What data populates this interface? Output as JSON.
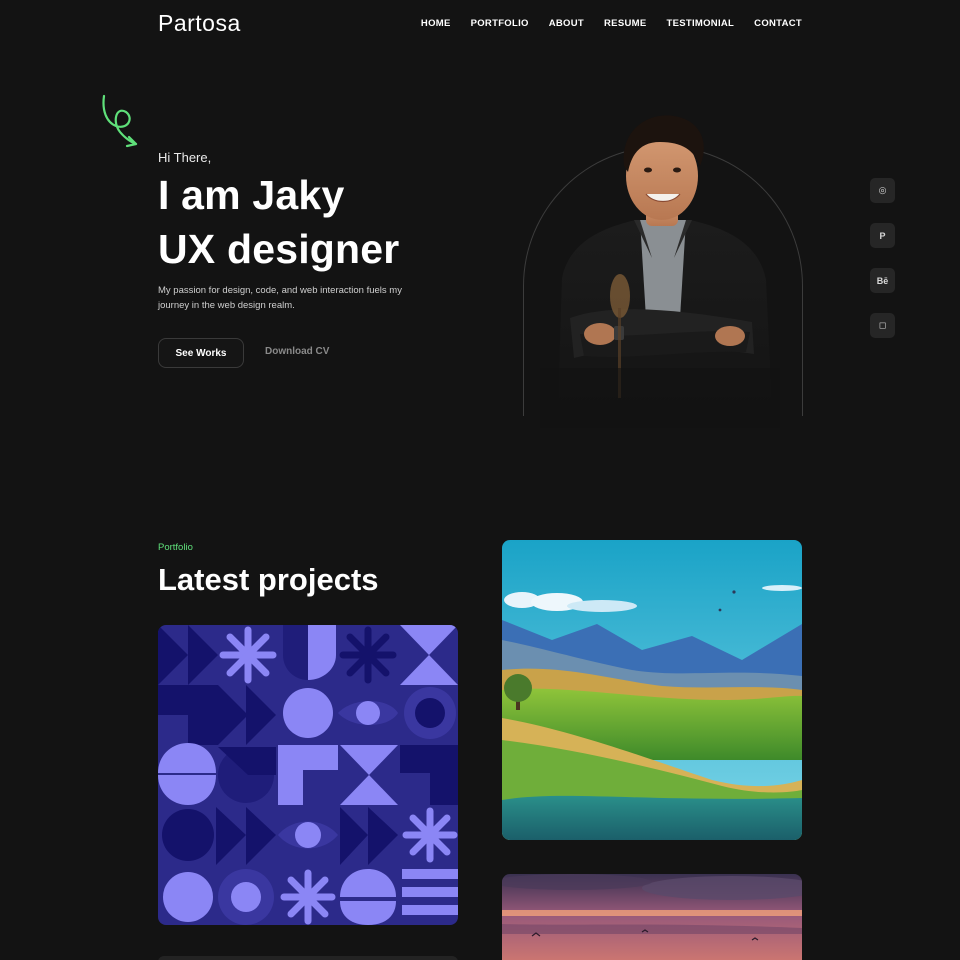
{
  "header": {
    "logo": "Partosa",
    "nav": [
      "HOME",
      "PORTFOLIO",
      "ABOUT",
      "RESUME",
      "TESTIMONIAL",
      "CONTACT"
    ]
  },
  "hero": {
    "greeting": "Hi There,",
    "headline_line1": "I am Jaky",
    "headline_line2": "UX designer",
    "intro": "My passion for design, code, and web interaction fuels my journey in the web design realm.",
    "primary_button": "See Works",
    "secondary_button": "Download CV"
  },
  "social": {
    "items": [
      {
        "icon": "dribbble-icon",
        "glyph": "◎"
      },
      {
        "icon": "pinterest-icon",
        "glyph": "P"
      },
      {
        "icon": "behance-icon",
        "glyph": "Bē"
      },
      {
        "icon": "instagram-icon",
        "glyph": "◻"
      }
    ]
  },
  "portfolio": {
    "label": "Portfolio",
    "title": "Latest projects",
    "projects": [
      {
        "image": "geometric-pattern-illustration"
      },
      {
        "image": "green-hills-landscape-illustration"
      },
      {
        "image": "sunset-sky-illustration"
      }
    ]
  },
  "colors": {
    "background": "#131313",
    "accent": "#5fe07a",
    "geo_dark": "#2c2a8a",
    "geo_light": "#8b86f5",
    "geo_navy": "#14126b"
  }
}
